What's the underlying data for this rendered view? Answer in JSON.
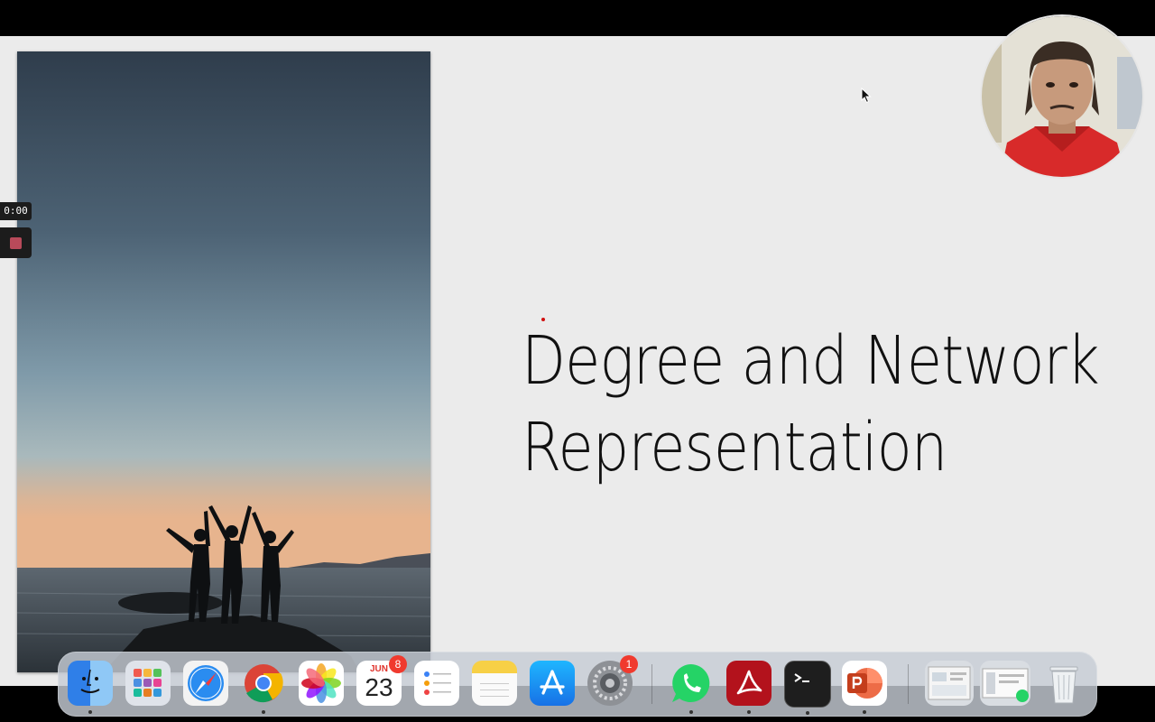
{
  "slide": {
    "title_line1": "Degree and Network",
    "title_line2": "Representation"
  },
  "recorder": {
    "elapsed": "0:00"
  },
  "dock": {
    "items": [
      {
        "name": "finder-icon"
      },
      {
        "name": "launchpad-icon"
      },
      {
        "name": "safari-icon"
      },
      {
        "name": "chrome-icon"
      },
      {
        "name": "photos-icon"
      },
      {
        "name": "calendar-icon",
        "month": "JUN",
        "day": "23",
        "badge": "8"
      },
      {
        "name": "reminders-icon"
      },
      {
        "name": "notes-icon"
      },
      {
        "name": "app-store-icon"
      },
      {
        "name": "system-settings-icon",
        "badge": "1"
      },
      {
        "name": "whatsapp-icon"
      },
      {
        "name": "acrobat-icon"
      },
      {
        "name": "terminal-icon"
      },
      {
        "name": "powerpoint-icon"
      },
      {
        "name": "recent-window-1"
      },
      {
        "name": "recent-window-2"
      },
      {
        "name": "trash-icon"
      }
    ]
  },
  "colors": {
    "slide_bg": "#ebebeb",
    "laser": "#d01010",
    "badge": "#f03a2e"
  }
}
